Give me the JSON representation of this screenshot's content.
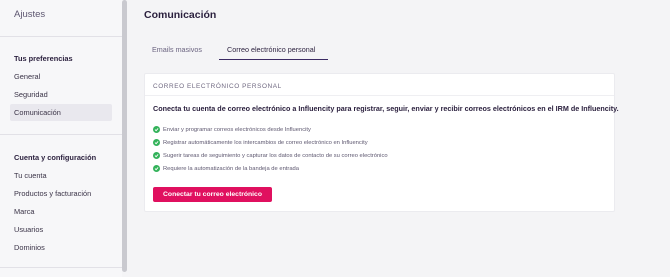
{
  "sidebar": {
    "title": "Ajustes",
    "sections": [
      {
        "heading": "Tus preferencias",
        "items": [
          "General",
          "Seguridad",
          "Comunicación"
        ]
      },
      {
        "heading": "Cuenta y configuración",
        "items": [
          "Tu cuenta",
          "Productos y facturación",
          "Marca",
          "Usuarios",
          "Dominios"
        ]
      }
    ],
    "active_item": "Comunicación"
  },
  "main": {
    "title": "Comunicación",
    "tabs": [
      {
        "label": "Emails masivos",
        "active": false
      },
      {
        "label": "Correo electrónico personal",
        "active": true
      }
    ],
    "card": {
      "label": "CORREO ELECTRÓNICO PERSONAL",
      "heading": "Conecta tu cuenta de correo electrónico a Influencity para registrar, seguir, enviar y recibir correos electrónicos en el IRM de Influencity.",
      "features": [
        "Enviar y programar correos electrónicos desde Influencity",
        "Registrar automáticamente los intercambios de correo electrónico en Influencity",
        "Sugerir tareas de seguimiento y capturar los datos de contacto de su correo electrónico",
        "Requiere la automatización de la bandeja de entrada"
      ],
      "button_label": "Conectar tu correo electrónico"
    }
  },
  "colors": {
    "accent": "#e0105f",
    "check": "#33b25a",
    "tab_underline": "#3b2a63"
  }
}
